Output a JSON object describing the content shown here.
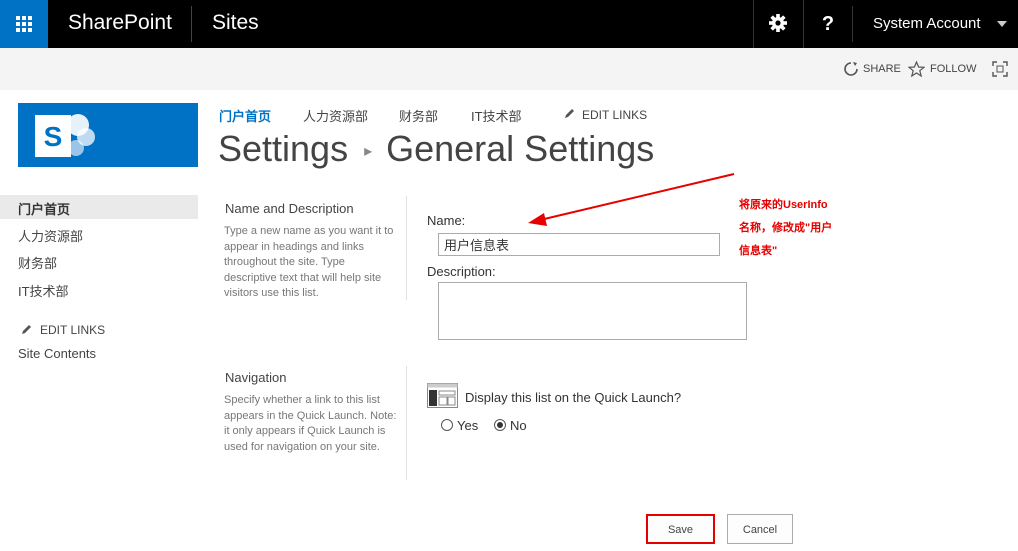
{
  "suite_bar": {
    "brand": "SharePoint",
    "section": "Sites",
    "help_label": "?",
    "account_name": "System Account"
  },
  "ribbon": {
    "share_label": "SHARE",
    "follow_label": "FOLLOW"
  },
  "top_nav": {
    "items": [
      "门户首页",
      "人力资源部",
      "财务部",
      "IT技术部"
    ],
    "edit_links_label": "EDIT LINKS"
  },
  "breadcrumb": {
    "parent": "Settings",
    "separator": "▸",
    "current": "General Settings"
  },
  "quick_launch": {
    "items": [
      "门户首页",
      "人力资源部",
      "财务部",
      "IT技术部"
    ],
    "edit_links_label": "EDIT LINKS",
    "site_contents_label": "Site Contents"
  },
  "form": {
    "name_section": {
      "title": "Name and Description",
      "description": "Type a new name as you want it to appear in headings and links throughout the site. Type descriptive text that will help site visitors use this list.",
      "name_label": "Name:",
      "name_value": "用户信息表",
      "description_label": "Description:",
      "description_value": ""
    },
    "navigation_section": {
      "title": "Navigation",
      "description": "Specify whether a link to this list appears in the Quick Launch. Note: it only appears if Quick Launch is used for navigation on your site.",
      "question": "Display this list on the Quick Launch?",
      "yes_label": "Yes",
      "no_label": "No",
      "selected": "No"
    },
    "save_label": "Save",
    "cancel_label": "Cancel"
  },
  "annotation": {
    "lines": [
      "将原来的UserInfo",
      "名称，修改成\"用户",
      "信息表\""
    ],
    "color": "#e60000"
  },
  "colors": {
    "suite_bar": "#000000",
    "accent": "#0072c6",
    "highlight_box": "#e60000"
  }
}
